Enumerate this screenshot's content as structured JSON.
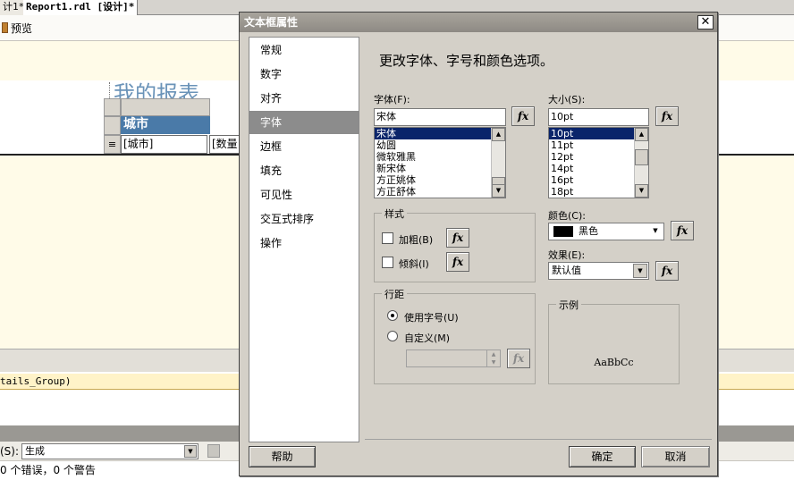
{
  "ide": {
    "tab1": "计1*",
    "tab2": "Report1.rdl [设计]*",
    "preview_label": "预览",
    "report_title": "我的报表",
    "header_cell": "城市",
    "data_cell": "[城市]",
    "data_cell2": "[数量",
    "row_handle": "≡",
    "group_text": "tails_Group)",
    "output_source_label": "(S):",
    "output_source_value": "生成",
    "output_text": "0 个错误，0 个警告"
  },
  "dialog": {
    "title": "文本框属性",
    "close": "✕",
    "nav_items": [
      "常规",
      "数字",
      "对齐",
      "字体",
      "边框",
      "填充",
      "可见性",
      "交互式排序",
      "操作"
    ],
    "nav_selected": 3,
    "heading": "更改字体、字号和颜色选项。",
    "font_label": "字体(F):",
    "font_value": "宋体",
    "font_list": [
      "宋体",
      "幼圆",
      "微软雅黑",
      "新宋体",
      "方正姚体",
      "方正舒体"
    ],
    "size_label": "大小(S):",
    "size_value": "10pt",
    "size_list": [
      "10pt",
      "11pt",
      "12pt",
      "14pt",
      "16pt",
      "18pt"
    ],
    "style_group": "样式",
    "bold_label": "加粗(B)",
    "italic_label": "倾斜(I)",
    "color_label": "颜色(C):",
    "color_value": "黑色",
    "color_swatch": "#000000",
    "effect_label": "效果(E):",
    "effect_value": "默认值",
    "spacing_group": "行距",
    "use_size_label": "使用字号(U)",
    "custom_label": "自定义(M)",
    "sample_group": "示例",
    "sample_text": "AaBbCc",
    "fx_label": "fx",
    "help_button": "帮助",
    "ok_button": "确定",
    "cancel_button": "取消"
  }
}
